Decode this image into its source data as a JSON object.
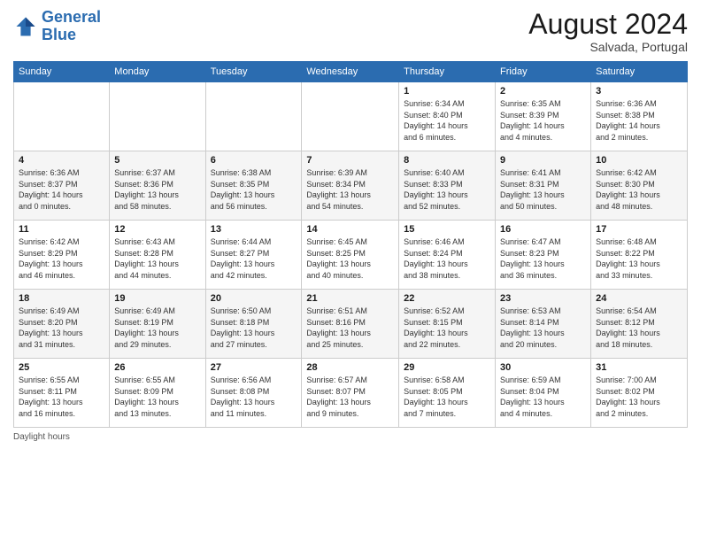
{
  "header": {
    "logo_line1": "General",
    "logo_line2": "Blue",
    "month_year": "August 2024",
    "location": "Salvada, Portugal"
  },
  "days_of_week": [
    "Sunday",
    "Monday",
    "Tuesday",
    "Wednesday",
    "Thursday",
    "Friday",
    "Saturday"
  ],
  "footer": {
    "label": "Daylight hours"
  },
  "weeks": [
    [
      {
        "day": "",
        "info": ""
      },
      {
        "day": "",
        "info": ""
      },
      {
        "day": "",
        "info": ""
      },
      {
        "day": "",
        "info": ""
      },
      {
        "day": "1",
        "info": "Sunrise: 6:34 AM\nSunset: 8:40 PM\nDaylight: 14 hours\nand 6 minutes."
      },
      {
        "day": "2",
        "info": "Sunrise: 6:35 AM\nSunset: 8:39 PM\nDaylight: 14 hours\nand 4 minutes."
      },
      {
        "day": "3",
        "info": "Sunrise: 6:36 AM\nSunset: 8:38 PM\nDaylight: 14 hours\nand 2 minutes."
      }
    ],
    [
      {
        "day": "4",
        "info": "Sunrise: 6:36 AM\nSunset: 8:37 PM\nDaylight: 14 hours\nand 0 minutes."
      },
      {
        "day": "5",
        "info": "Sunrise: 6:37 AM\nSunset: 8:36 PM\nDaylight: 13 hours\nand 58 minutes."
      },
      {
        "day": "6",
        "info": "Sunrise: 6:38 AM\nSunset: 8:35 PM\nDaylight: 13 hours\nand 56 minutes."
      },
      {
        "day": "7",
        "info": "Sunrise: 6:39 AM\nSunset: 8:34 PM\nDaylight: 13 hours\nand 54 minutes."
      },
      {
        "day": "8",
        "info": "Sunrise: 6:40 AM\nSunset: 8:33 PM\nDaylight: 13 hours\nand 52 minutes."
      },
      {
        "day": "9",
        "info": "Sunrise: 6:41 AM\nSunset: 8:31 PM\nDaylight: 13 hours\nand 50 minutes."
      },
      {
        "day": "10",
        "info": "Sunrise: 6:42 AM\nSunset: 8:30 PM\nDaylight: 13 hours\nand 48 minutes."
      }
    ],
    [
      {
        "day": "11",
        "info": "Sunrise: 6:42 AM\nSunset: 8:29 PM\nDaylight: 13 hours\nand 46 minutes."
      },
      {
        "day": "12",
        "info": "Sunrise: 6:43 AM\nSunset: 8:28 PM\nDaylight: 13 hours\nand 44 minutes."
      },
      {
        "day": "13",
        "info": "Sunrise: 6:44 AM\nSunset: 8:27 PM\nDaylight: 13 hours\nand 42 minutes."
      },
      {
        "day": "14",
        "info": "Sunrise: 6:45 AM\nSunset: 8:25 PM\nDaylight: 13 hours\nand 40 minutes."
      },
      {
        "day": "15",
        "info": "Sunrise: 6:46 AM\nSunset: 8:24 PM\nDaylight: 13 hours\nand 38 minutes."
      },
      {
        "day": "16",
        "info": "Sunrise: 6:47 AM\nSunset: 8:23 PM\nDaylight: 13 hours\nand 36 minutes."
      },
      {
        "day": "17",
        "info": "Sunrise: 6:48 AM\nSunset: 8:22 PM\nDaylight: 13 hours\nand 33 minutes."
      }
    ],
    [
      {
        "day": "18",
        "info": "Sunrise: 6:49 AM\nSunset: 8:20 PM\nDaylight: 13 hours\nand 31 minutes."
      },
      {
        "day": "19",
        "info": "Sunrise: 6:49 AM\nSunset: 8:19 PM\nDaylight: 13 hours\nand 29 minutes."
      },
      {
        "day": "20",
        "info": "Sunrise: 6:50 AM\nSunset: 8:18 PM\nDaylight: 13 hours\nand 27 minutes."
      },
      {
        "day": "21",
        "info": "Sunrise: 6:51 AM\nSunset: 8:16 PM\nDaylight: 13 hours\nand 25 minutes."
      },
      {
        "day": "22",
        "info": "Sunrise: 6:52 AM\nSunset: 8:15 PM\nDaylight: 13 hours\nand 22 minutes."
      },
      {
        "day": "23",
        "info": "Sunrise: 6:53 AM\nSunset: 8:14 PM\nDaylight: 13 hours\nand 20 minutes."
      },
      {
        "day": "24",
        "info": "Sunrise: 6:54 AM\nSunset: 8:12 PM\nDaylight: 13 hours\nand 18 minutes."
      }
    ],
    [
      {
        "day": "25",
        "info": "Sunrise: 6:55 AM\nSunset: 8:11 PM\nDaylight: 13 hours\nand 16 minutes."
      },
      {
        "day": "26",
        "info": "Sunrise: 6:55 AM\nSunset: 8:09 PM\nDaylight: 13 hours\nand 13 minutes."
      },
      {
        "day": "27",
        "info": "Sunrise: 6:56 AM\nSunset: 8:08 PM\nDaylight: 13 hours\nand 11 minutes."
      },
      {
        "day": "28",
        "info": "Sunrise: 6:57 AM\nSunset: 8:07 PM\nDaylight: 13 hours\nand 9 minutes."
      },
      {
        "day": "29",
        "info": "Sunrise: 6:58 AM\nSunset: 8:05 PM\nDaylight: 13 hours\nand 7 minutes."
      },
      {
        "day": "30",
        "info": "Sunrise: 6:59 AM\nSunset: 8:04 PM\nDaylight: 13 hours\nand 4 minutes."
      },
      {
        "day": "31",
        "info": "Sunrise: 7:00 AM\nSunset: 8:02 PM\nDaylight: 13 hours\nand 2 minutes."
      }
    ]
  ]
}
